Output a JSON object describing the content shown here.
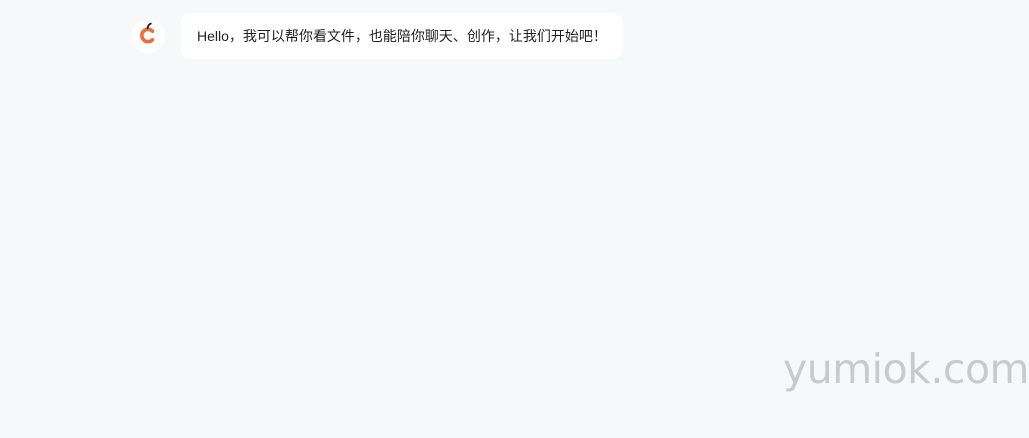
{
  "chat": {
    "messages": [
      {
        "role": "assistant",
        "avatar_icon": "assistant-logo-icon",
        "text": "Hello，我可以帮你看文件，也能陪你聊天、创作，让我们开始吧！"
      }
    ]
  },
  "watermark": {
    "text": "yumiok.com"
  },
  "colors": {
    "background": "#f7f8fa",
    "bubble": "#ffffff",
    "logo_orange": "#f26b3a",
    "text": "#1f1f1f",
    "watermark": "#c9cacc"
  }
}
